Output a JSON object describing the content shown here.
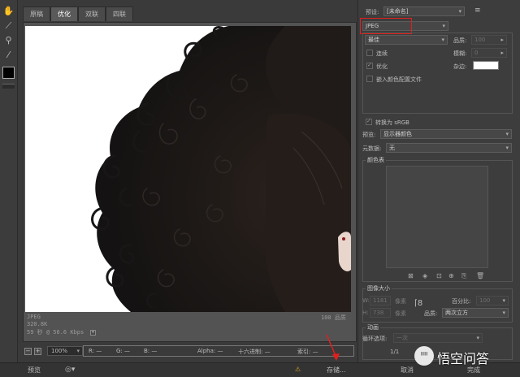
{
  "tabs": [
    "原稿",
    "优化",
    "双联",
    "四联"
  ],
  "active_tab": "优化",
  "image_info": {
    "format": "JPEG",
    "size": "320.8K",
    "time": "59 秒 @ 56.6 Kbps",
    "quality": "100 品质"
  },
  "status_bar": {
    "zoom": "100%",
    "r": "R: —",
    "g": "G: —",
    "b": "B: —",
    "alpha": "Alpha: —",
    "hex": "十六进制: —",
    "index": "索引: —"
  },
  "bottom_bar": {
    "preview": "预览",
    "save": "存储...",
    "cancel": "取消",
    "done": "完成"
  },
  "settings": {
    "preset_label": "预设:",
    "preset_value": "[未命名]",
    "format_value": "JPEG",
    "quality_level": "最佳",
    "quality_label": "品质:",
    "quality_value": "100",
    "progressive_label": "连续",
    "blur_label": "模糊:",
    "blur_value": "0",
    "optimized_label": "优化",
    "matte_label": "杂边:",
    "embed_profile_label": "嵌入颜色配置文件",
    "srgb_label": "转换为 sRGB",
    "preview_label": "预览:",
    "preview_value": "显示器颜色",
    "metadata_label": "元数据:",
    "metadata_value": "无",
    "color_table_title": "颜色表",
    "image_size_title": "图像大小",
    "width_label": "W:",
    "width_value": "1181",
    "height_label": "H:",
    "height_value": "738",
    "unit": "像素",
    "percent_label": "百分比:",
    "percent_value": "100",
    "resample_label": "品质:",
    "resample_value": "两次立方",
    "animation_title": "动画",
    "loop_label": "循环选项:",
    "loop_value": "一次",
    "frame_counter": "1/1"
  },
  "watermark": {
    "text": "悟空问答"
  }
}
